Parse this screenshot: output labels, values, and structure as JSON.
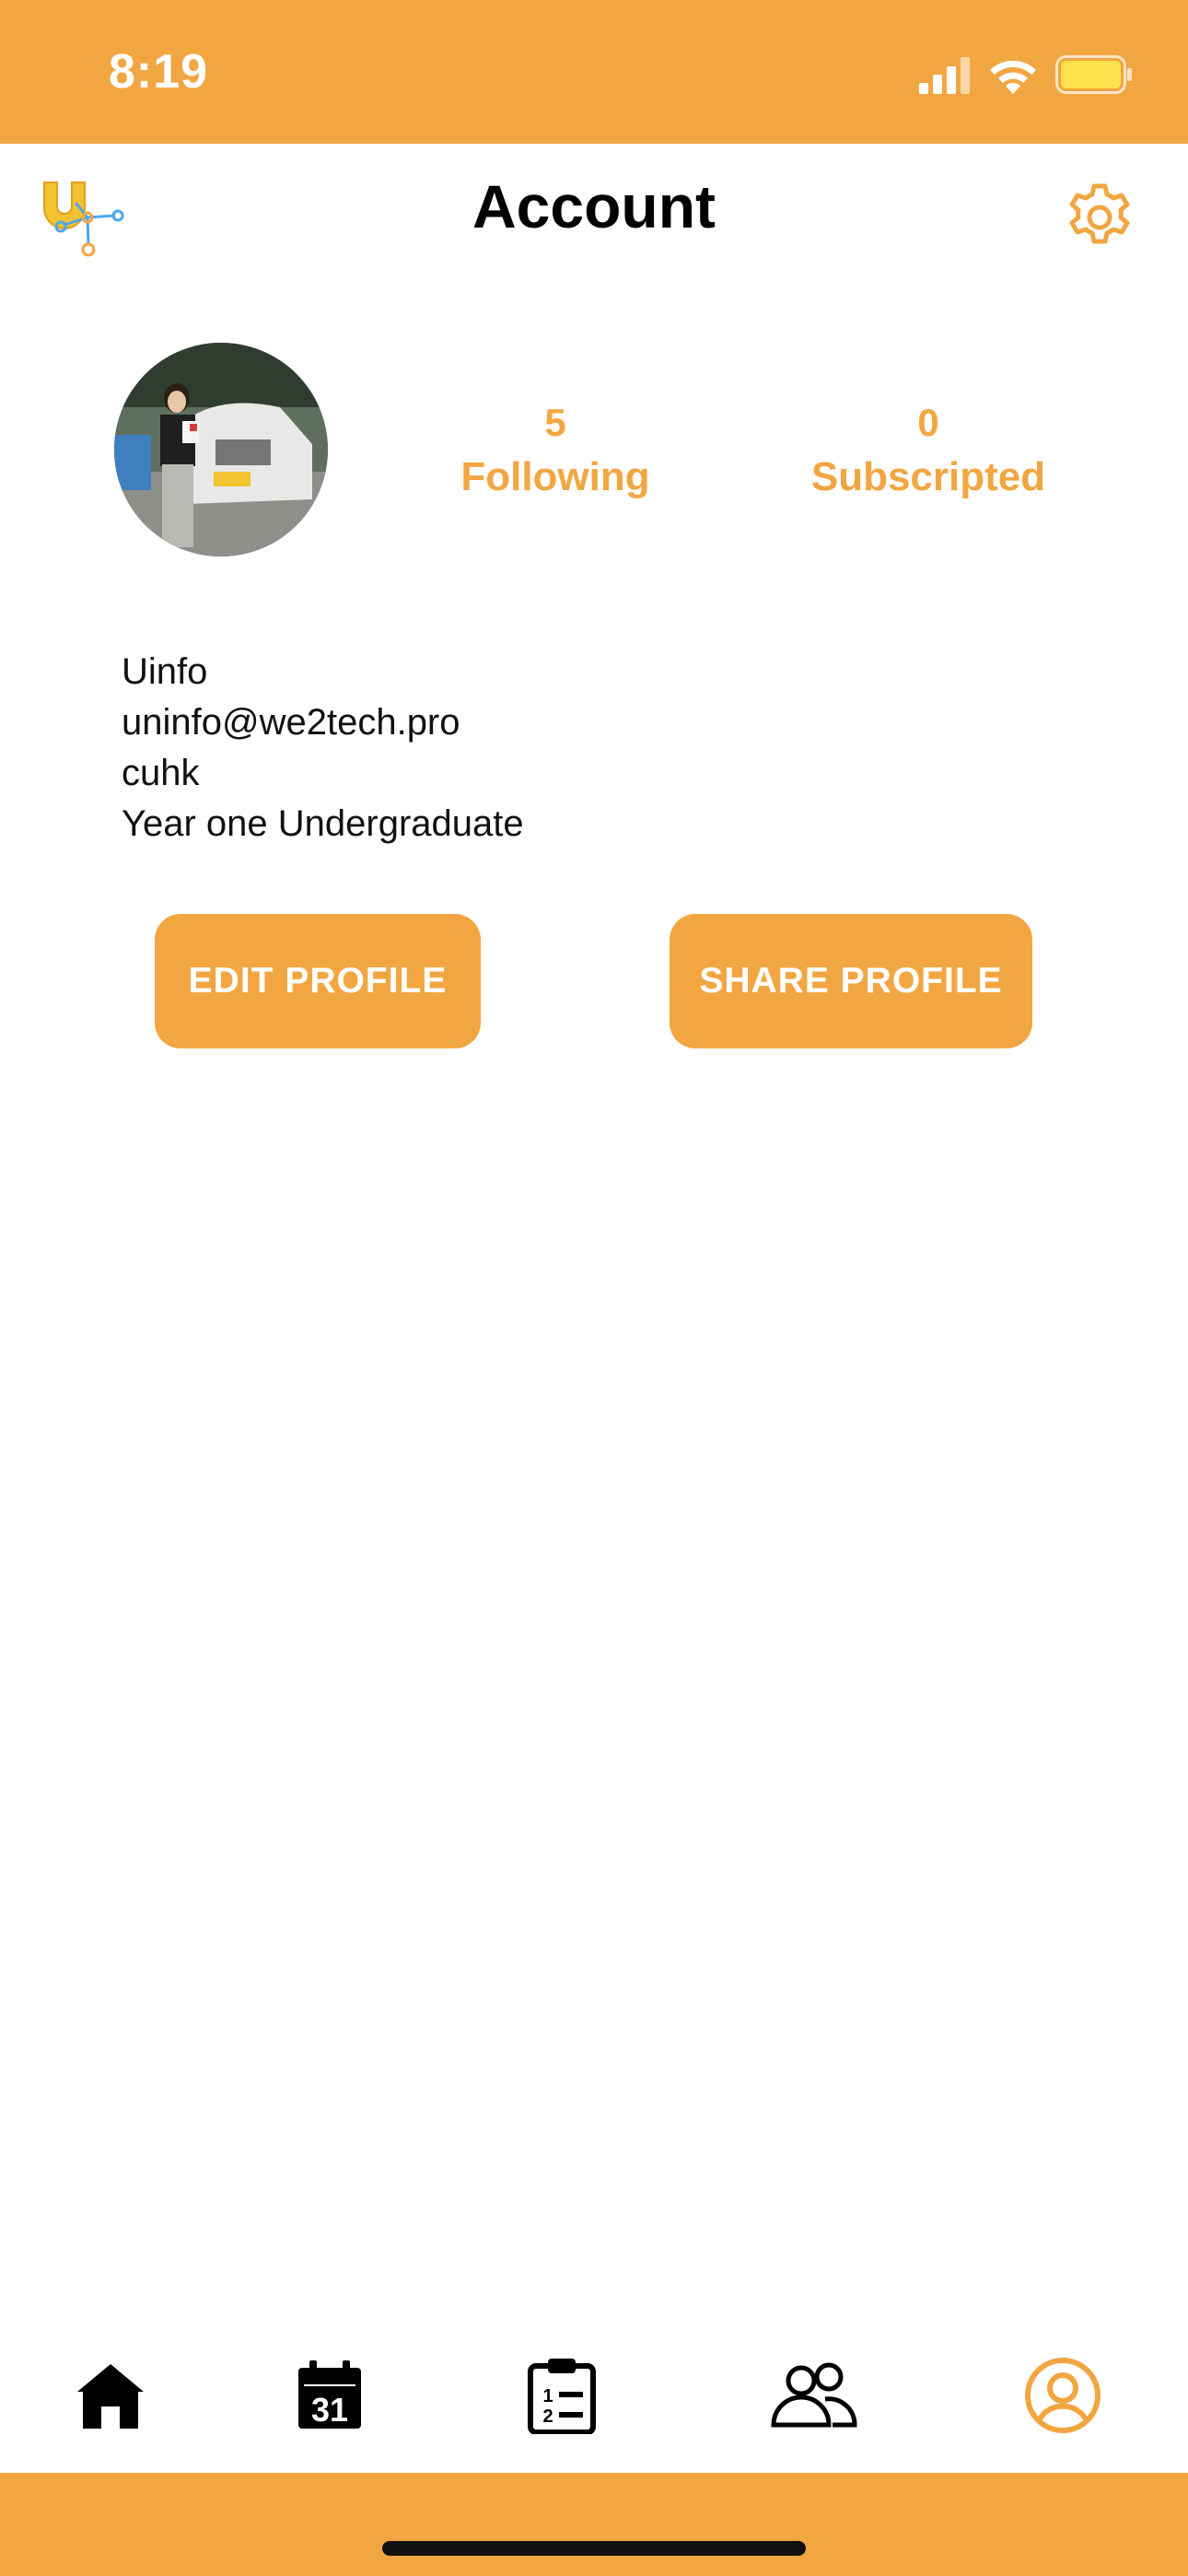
{
  "status_bar": {
    "time": "8:19",
    "icons": [
      "signal-icon",
      "wifi-icon",
      "battery-icon"
    ]
  },
  "header": {
    "title": "Account",
    "logo_icon": "uinfo-logo",
    "settings_icon": "gear-icon"
  },
  "profile": {
    "avatar": "user-avatar-photo",
    "stats": [
      {
        "count": "5",
        "label": "Following"
      },
      {
        "count": "0",
        "label": "Subscripted"
      }
    ],
    "info": {
      "name": "Uinfo",
      "email": "uninfo@we2tech.pro",
      "school": "cuhk",
      "year": "Year one Undergraduate"
    }
  },
  "actions": {
    "edit_label": "EDIT PROFILE",
    "share_label": "SHARE PROFILE"
  },
  "tab_bar": {
    "tabs": [
      {
        "icon": "home-icon",
        "active": false
      },
      {
        "icon": "calendar-icon",
        "active": false
      },
      {
        "icon": "clipboard-list-icon",
        "active": false
      },
      {
        "icon": "people-icon",
        "active": false
      },
      {
        "icon": "profile-icon",
        "active": true
      }
    ],
    "calendar_day": "31",
    "checklist_numbers": [
      "1",
      "2"
    ]
  },
  "colors": {
    "accent": "#F2A641",
    "text": "#000000",
    "background": "#FFFFFF"
  }
}
